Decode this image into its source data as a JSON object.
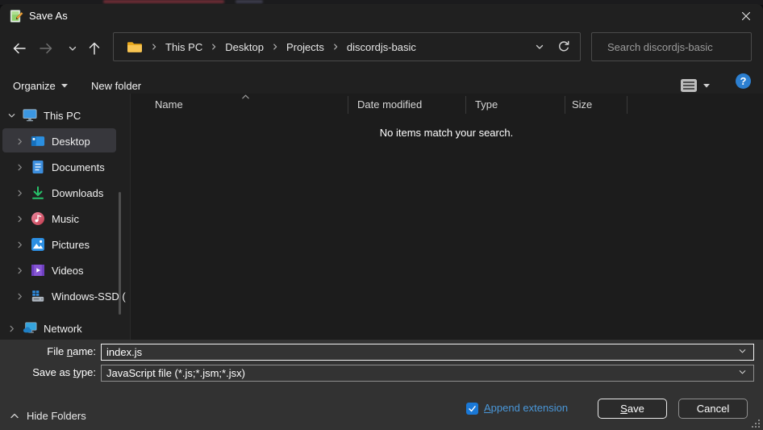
{
  "window": {
    "title": "Save As"
  },
  "nav": {
    "breadcrumb": [
      "This PC",
      "Desktop",
      "Projects",
      "discordjs-basic"
    ],
    "search_placeholder": "Search discordjs-basic"
  },
  "toolbar": {
    "organize": "Organize",
    "new_folder": "New folder"
  },
  "list": {
    "columns": [
      "Name",
      "Date modified",
      "Type",
      "Size"
    ],
    "empty_message": "No items match your search."
  },
  "sidebar": {
    "items": [
      {
        "label": "This PC"
      },
      {
        "label": "Desktop"
      },
      {
        "label": "Documents"
      },
      {
        "label": "Downloads"
      },
      {
        "label": "Music"
      },
      {
        "label": "Pictures"
      },
      {
        "label": "Videos"
      },
      {
        "label": "Windows-SSD ("
      },
      {
        "label": "Network"
      }
    ]
  },
  "form": {
    "file_name_label": {
      "pre": "File ",
      "u": "n",
      "post": "ame:"
    },
    "file_name_value": "index.js",
    "save_type_label": {
      "pre": "Save as ",
      "u": "t",
      "post": "ype:"
    },
    "save_type_value": "JavaScript file (*.js;*.jsm;*.jsx)"
  },
  "footer": {
    "hide_folders": "Hide Folders",
    "append_extension": {
      "pre": "",
      "u": "A",
      "post": "ppend extension"
    },
    "save": {
      "pre": "",
      "u": "S",
      "post": "ave"
    },
    "cancel": "Cancel"
  },
  "colors": {
    "accent_blue": "#2c7fd0",
    "checkbox_blue": "#1a78d6",
    "selection": "#37373c",
    "panel": "#333333",
    "window": "#202020"
  }
}
